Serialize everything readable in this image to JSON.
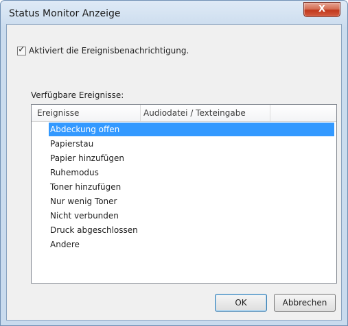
{
  "window": {
    "title": "Status Monitor Anzeige",
    "close_glyph": "X"
  },
  "notification": {
    "checked": true,
    "label": "Aktiviert die Ereignisbenachrichtigung."
  },
  "events_group": {
    "label": "Verfügbare Ereignisse:",
    "columns": [
      "Ereignisse",
      "Audiodatei / Texteingabe"
    ],
    "items": [
      "Abdeckung offen",
      "Papierstau",
      "Papier hinzufügen",
      "Ruhemodus",
      "Toner hinzufügen",
      "Nur wenig Toner",
      "Nicht verbunden",
      "Druck abgeschlossen",
      "Andere"
    ],
    "selected_index": 0
  },
  "buttons": {
    "ok": "OK",
    "cancel": "Abbrechen"
  },
  "colors": {
    "selection": "#3399ff",
    "close_button": "#c1391d"
  }
}
